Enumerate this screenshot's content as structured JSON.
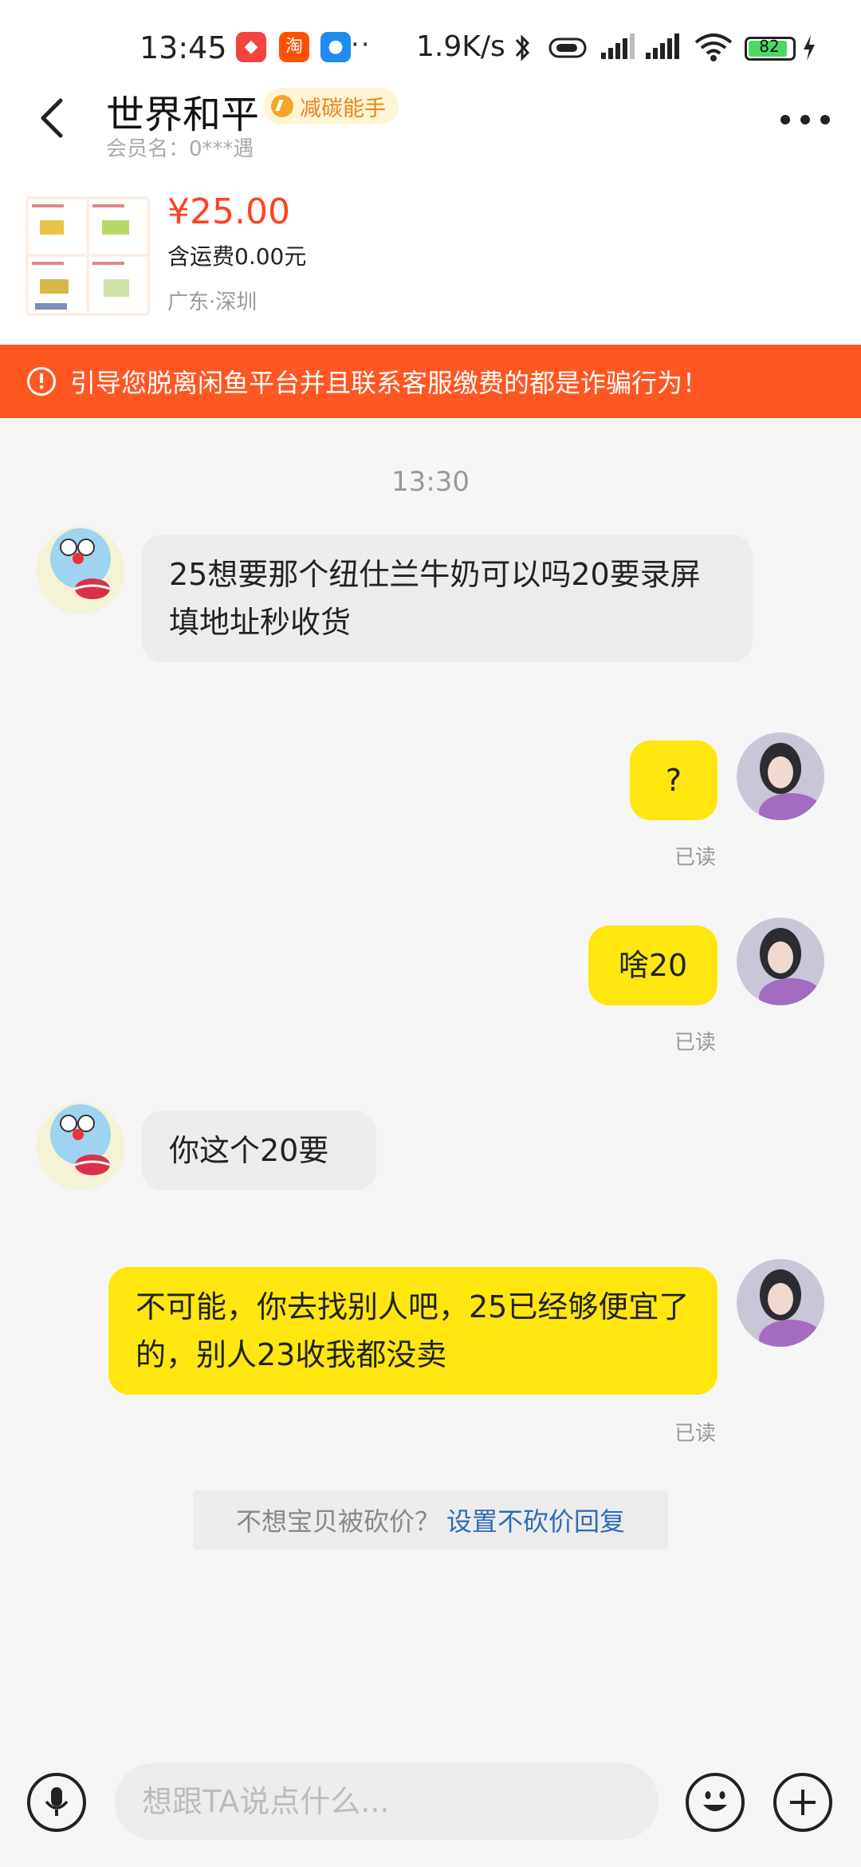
{
  "status_bar": {
    "time": "13:45",
    "dots": "··",
    "speed": "1.9K/s",
    "battery": "82"
  },
  "header": {
    "title": "世界和平",
    "badge": "减碳能手",
    "member": "会员名：0***遇"
  },
  "product": {
    "price": "¥25.00",
    "shipping": "含运费0.00元",
    "location": "广东·深圳"
  },
  "warning": "引导您脱离闲鱼平台并且联系客服缴费的都是诈骗行为！",
  "chat": {
    "timestamp": "13:30",
    "messages": [
      {
        "side": "left",
        "text": "25想要那个纽仕兰牛奶可以吗20要录屏填地址秒收货"
      },
      {
        "side": "right",
        "text": "?",
        "status": "已读"
      },
      {
        "side": "right",
        "text": "啥20",
        "status": "已读"
      },
      {
        "side": "left",
        "text": "你这个20要"
      },
      {
        "side": "right",
        "text": "不可能，你去找别人吧，25已经够便宜了的，别人23收我都没卖",
        "status": "已读"
      }
    ],
    "tip_text": "不想宝贝被砍价？",
    "tip_link": "设置不砍价回复"
  },
  "input_bar": {
    "placeholder": "想跟TA说点什么..."
  },
  "colors": {
    "accent_orange": "#ff5722",
    "price_red": "#ff4222",
    "bubble_yellow": "#ffe60f",
    "bubble_gray": "#ececef",
    "link_blue": "#2f6cb5"
  },
  "icons": [
    "back-arrow-icon",
    "more-icon",
    "warning-icon",
    "microphone-icon",
    "emoji-icon",
    "plus-icon"
  ]
}
